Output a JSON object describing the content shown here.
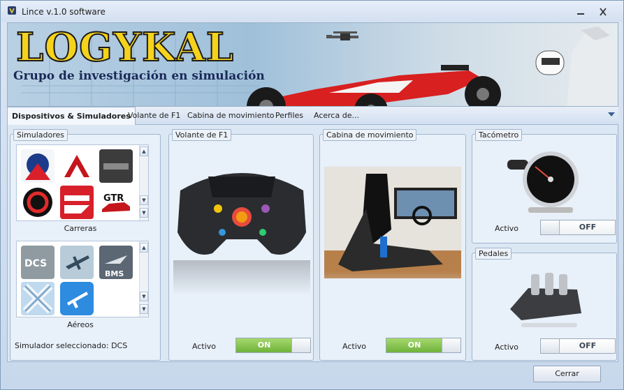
{
  "window": {
    "title": "Lince v.1.0 software"
  },
  "banner": {
    "logo": "LOGYKAL",
    "subtitle": "Grupo de investigación en simulación"
  },
  "tabs": [
    {
      "label": "Dispositivos & Simuladores",
      "active": true
    },
    {
      "label": "Volante de F1",
      "active": false
    },
    {
      "label": "Cabina de movimiento",
      "active": false
    },
    {
      "label": "Perfiles",
      "active": false
    },
    {
      "label": "Acerca de...",
      "active": false
    }
  ],
  "simuladores": {
    "title": "Simuladores",
    "carreras": {
      "label": "Carreras",
      "icons": [
        "iracing-icon",
        "assetto-corsa-icon",
        "project-cars-icon",
        "rfactor-icon",
        "rfactor2-icon",
        "gtr-icon"
      ]
    },
    "aereos": {
      "label": "Aéreos",
      "icons": [
        "dcs-icon",
        "il2-icon",
        "bms-icon",
        "xplane-icon",
        "fsx-icon"
      ]
    },
    "selected_text": "Simulador seleccionado: DCS"
  },
  "volante": {
    "title": "Volante de F1",
    "status_label": "Activo",
    "toggle": "ON",
    "state": "on"
  },
  "cabina": {
    "title": "Cabina de movimiento",
    "status_label": "Activo",
    "toggle": "ON",
    "state": "on"
  },
  "tacometro": {
    "title": "Tacómetro",
    "status_label": "Activo",
    "toggle": "OFF",
    "state": "off"
  },
  "pedales": {
    "title": "Pedales",
    "status_label": "Activo",
    "toggle": "OFF",
    "state": "off"
  },
  "footer": {
    "close_label": "Cerrar"
  },
  "colors": {
    "toggle_on": "#7cbd43",
    "border": "#9fb5cf",
    "logo_yellow": "#f5d21c"
  }
}
